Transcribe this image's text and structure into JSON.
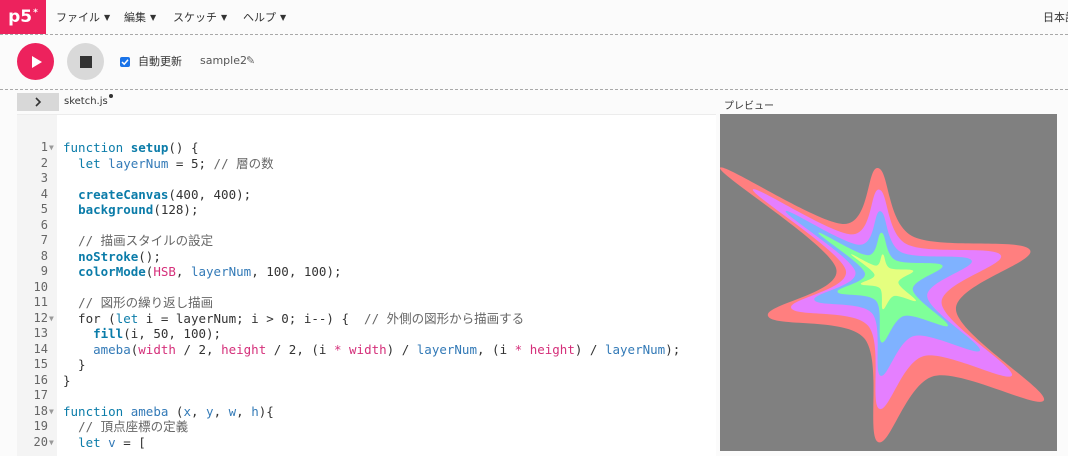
{
  "app": {
    "logo": "p5",
    "logo_mark": "*"
  },
  "menu": [
    {
      "label": "ファイル"
    },
    {
      "label": "編集"
    },
    {
      "label": "スケッチ"
    },
    {
      "label": "ヘルプ"
    }
  ],
  "language": {
    "label": "日本語"
  },
  "toolbar": {
    "autorefresh_label": "自動更新",
    "autorefresh_checked": true,
    "sketch_name": "sample2"
  },
  "editor": {
    "file_tab": "sketch.js",
    "preview_label": "プレビュー",
    "lines": [
      "function setup() {",
      "  let layerNum = 5; // 層の数",
      "",
      "  createCanvas(400, 400);",
      "  background(128);",
      "",
      "  // 描画スタイルの設定",
      "  noStroke();",
      "  colorMode(HSB, layerNum, 100, 100);",
      "",
      "  // 図形の繰り返し描画",
      "  for (let i = layerNum; i > 0; i--) {  // 外側の図形から描画する",
      "    fill(i, 50, 100);",
      "    ameba(width / 2, height / 2, (i * width) / layerNum, (i * height) / layerNum);",
      "  }",
      "}",
      "",
      "function ameba (x, y, w, h){",
      "  // 頂点座標の定義",
      "  let v = ["
    ],
    "fold_lines": [
      1,
      12,
      18,
      20
    ]
  },
  "colors": {
    "accent": "#ed225d",
    "canvas_bg": "#808080",
    "layers": [
      "#ff7f7f",
      "#e57fff",
      "#7fb2ff",
      "#7fff99",
      "#e5ff7f"
    ]
  }
}
